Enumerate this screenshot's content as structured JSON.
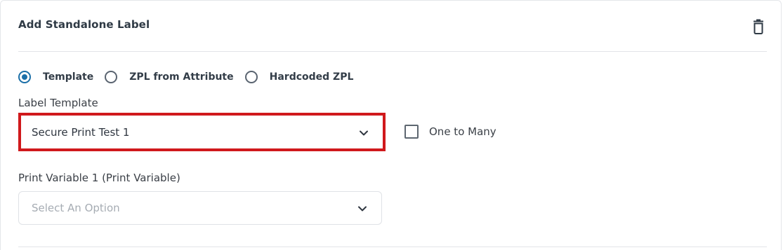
{
  "section": {
    "title": "Add Standalone Label"
  },
  "label_source": {
    "options": [
      {
        "label": "Template",
        "selected": true
      },
      {
        "label": "ZPL from Attribute",
        "selected": false
      },
      {
        "label": "Hardcoded ZPL",
        "selected": false
      }
    ]
  },
  "label_template": {
    "label": "Label Template",
    "value": "Secure Print Test 1",
    "highlight_color": "#d0191c"
  },
  "one_to_many": {
    "label": "One to Many",
    "checked": false
  },
  "print_variable": {
    "label": "Print Variable 1 (Print Variable)",
    "placeholder": "Select An Option"
  },
  "icons": {
    "delete": "trash-icon",
    "dropdown": "chevron-down-icon"
  },
  "colors": {
    "accent": "#1b6fa8",
    "text": "#2f3a45",
    "border": "#dfe2e6"
  }
}
